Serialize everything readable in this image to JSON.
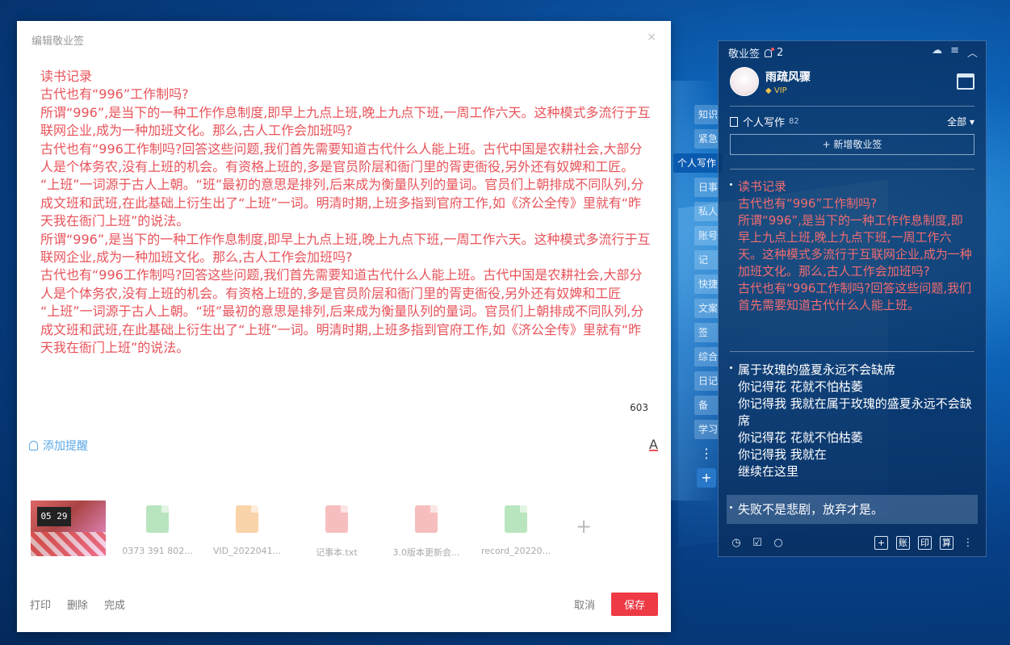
{
  "editor": {
    "title": "编辑敬业签",
    "close": "×",
    "content": "读书记录\n古代也有“996”工作制吗?\n所谓“996”,是当下的一种工作作息制度,即早上九点上班,晚上九点下班,一周工作六天。这种模式多流行于互联网企业,成为一种加班文化。那么,古人工作会加班吗?\n古代也有“996工作制吗?回答这些问题,我们首先需要知道古代什么人能上班。古代中国是农耕社会,大部分人是个体务农,没有上班的机会。有资格上班的,多是官员阶层和衙门里的胥吏衙役,另外还有奴婢和工匠。\n“上班”一词源于古人上朝。“班”最初的意思是排列,后来成为衡量队列的量词。官员们上朝排成不同队列,分成文班和武班,在此基础上衍生出了“上班”一词。明清时期,上班多指到官府工作,如《济公全传》里就有“昨天我在衙门上班”的说法。\n所谓“996”,是当下的一种工作作息制度,即早上九点上班,晚上九点下班,一周工作六天。这种模式多流行于互联网企业,成为一种加班文化。那么,古人工作会加班吗?\n古代也有“996工作制吗?回答这些问题,我们首先需要知道古代什么人能上班。古代中国是农耕社会,大部分人是个体务农,没有上班的机会。有资格上班的,多是官员阶层和衙门里的胥吏衙役,另外还有奴婢和工匠\n“上班”一词源于古人上朝。“班”最初的意思是排列,后来成为衡量队列的量词。官员们上朝排成不同队列,分成文班和武班,在此基础上衍生出了“上班”一词。明清时期,上班多指到官府工作,如《济公全传》里就有“昨天我在衙门上班”的说法。",
    "char_count": "603",
    "reminder_label": "添加提醒",
    "font_color_label": "A",
    "image_time": "05 29",
    "attachments": [
      {
        "name": "0373 391 802...",
        "color": "#7fd18a"
      },
      {
        "name": "VID_2022041...",
        "color": "#f5b063"
      },
      {
        "name": "记事本.txt",
        "color": "#f08a8a"
      },
      {
        "name": "3.0版本更新会...",
        "color": "#f08a8a"
      },
      {
        "name": "record_20220...",
        "color": "#7fd18a"
      }
    ],
    "add_attachment": "+",
    "footer": {
      "print": "打印",
      "delete": "删除",
      "done": "完成",
      "cancel": "取消",
      "save": "保存"
    }
  },
  "side_tabs": [
    "知识",
    "紧急",
    "个人写作",
    "日事",
    "私人",
    "账号",
    "记",
    "快捷",
    "文案",
    "签",
    "综合",
    "日记",
    "备",
    "学习"
  ],
  "side_more": "⋮",
  "side_add": "+",
  "panel": {
    "app_name": "敬业签",
    "reminder_count": "2",
    "window_controls": [
      "☁",
      "≡",
      "︿"
    ],
    "username": "雨疏风骤",
    "vip": "VIP",
    "section_title": "个人写作",
    "section_count": "82",
    "filter_label": "全部 ▾",
    "new_button": "+ 新增敬业签",
    "notes": [
      {
        "text": "读书记录\n古代也有“996”工作制吗?\n所谓“996”,是当下的一种工作作息制度,即早上九点上班,晚上九点下班,一周工作六天。这种模式多流行于互联网企业,成为一种加班文化。那么,古人工作会加班吗?\n古代也有“996工作制吗?回答这些问题,我们首先需要知道古代什么人能上班。",
        "color": "#f06c71"
      },
      {
        "text": "属于玫瑰的盛夏永远不会缺席\n你记得花 花就不怕枯萎\n你记得我 我就在属于玫瑰的盛夏永远不会缺席\n你记得花 花就不怕枯萎\n你记得我 我就在\n继续在这里",
        "color": "#ffffff"
      },
      {
        "text": "失败不是悲剧，放弃才是。",
        "color": "#ffffff"
      }
    ],
    "bottom_icons": [
      "clock-icon",
      "checklist-icon",
      "search-icon"
    ],
    "bottom_buttons": [
      "+",
      "账",
      "印",
      "算",
      "⋮"
    ]
  }
}
